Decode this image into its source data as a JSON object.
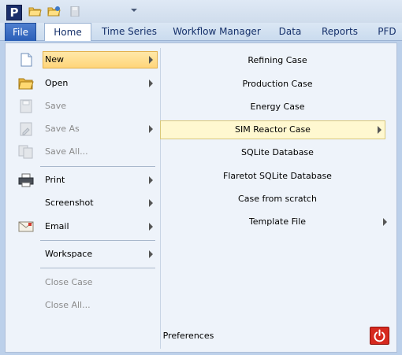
{
  "app": {
    "logo_letter": "P"
  },
  "tabs": [
    "File",
    "Home",
    "Time Series",
    "Workflow Manager",
    "Data",
    "Reports",
    "PFD"
  ],
  "left_menu": [
    {
      "label": "New",
      "icon": "new-document-icon",
      "submenu": true,
      "enabled": true,
      "selected": true
    },
    {
      "label": "Open",
      "icon": "open-folder-icon",
      "submenu": true,
      "enabled": true
    },
    {
      "label": "Save",
      "icon": "save-disk-icon",
      "submenu": false,
      "enabled": false
    },
    {
      "label": "Save As",
      "icon": "save-as-icon",
      "submenu": true,
      "enabled": false
    },
    {
      "label": "Save All...",
      "icon": "save-all-icon",
      "submenu": false,
      "enabled": false
    },
    {
      "label": "Print",
      "icon": "printer-icon",
      "submenu": true,
      "enabled": true
    },
    {
      "label": "Screenshot",
      "icon": "",
      "submenu": true,
      "enabled": true
    },
    {
      "label": "Email",
      "icon": "email-icon",
      "submenu": true,
      "enabled": true
    },
    {
      "label": "Workspace",
      "icon": "",
      "submenu": true,
      "enabled": true
    },
    {
      "label": "Close Case",
      "icon": "",
      "submenu": false,
      "enabled": false
    },
    {
      "label": "Close All...",
      "icon": "",
      "submenu": false,
      "enabled": false
    }
  ],
  "right_menu": [
    {
      "label": "Refining Case",
      "submenu": false
    },
    {
      "label": "Production Case",
      "submenu": false
    },
    {
      "label": "Energy Case",
      "submenu": false
    },
    {
      "label": "SIM Reactor Case",
      "submenu": true,
      "hover": true
    },
    {
      "label": "SQLite Database",
      "submenu": false
    },
    {
      "label": "Flaretot SQLite Database",
      "submenu": false
    },
    {
      "label": "Case from scratch",
      "submenu": false
    },
    {
      "label": "Template File",
      "submenu": true
    }
  ],
  "footer": {
    "preferences": "Preferences",
    "exit_icon": "power-icon"
  },
  "colors": {
    "file_tab": "#2a5fb8",
    "selected_item": "#ffd57a",
    "hover_item": "#fff8d0",
    "exit_button": "#d62a1f"
  }
}
